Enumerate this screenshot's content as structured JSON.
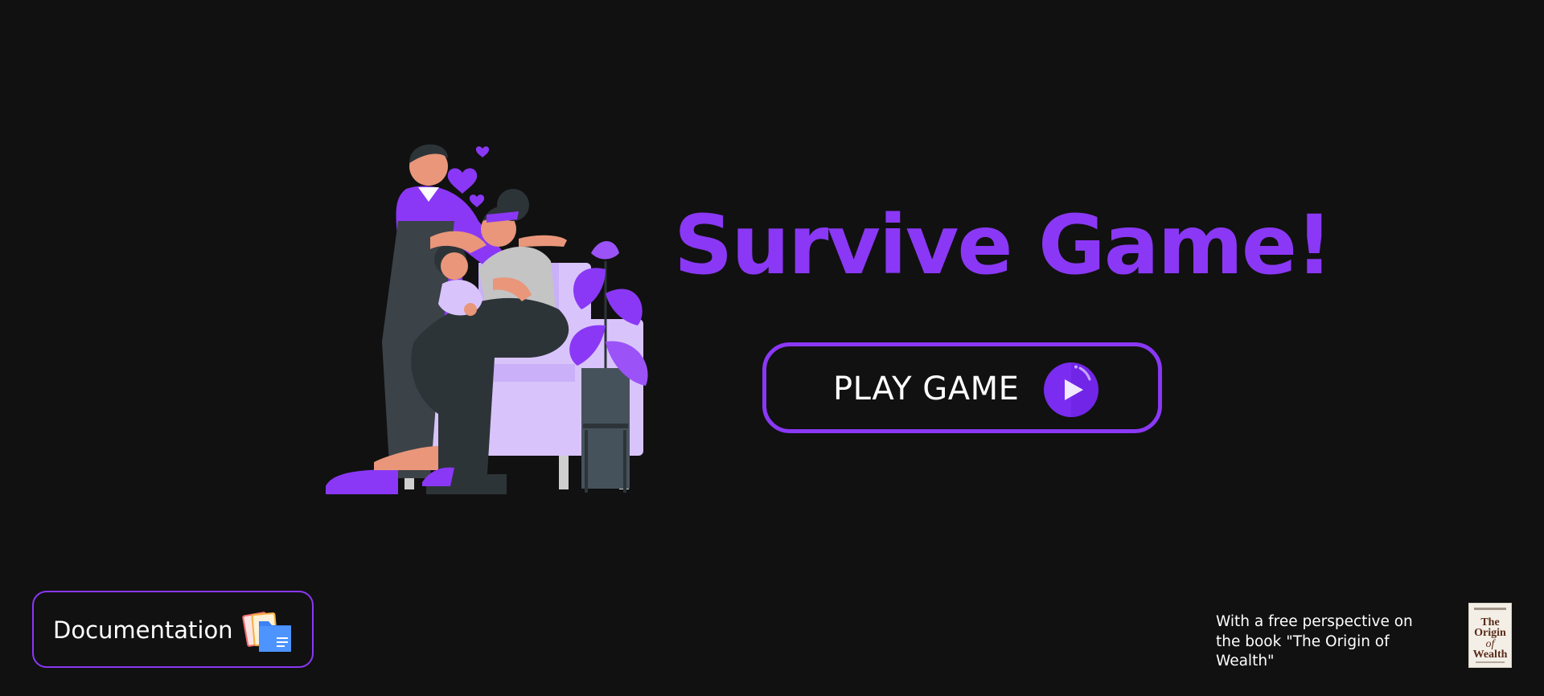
{
  "hero": {
    "title": "Survive Game!",
    "illustration": "family-on-sofa-illustration"
  },
  "play": {
    "label": "PLAY GAME",
    "icon": "play-icon"
  },
  "documentation": {
    "label": "Documentation",
    "icon": "folder-icon"
  },
  "footer": {
    "caption": "With a free perspective on the book \"The Origin of Wealth\"",
    "book_cover": {
      "title_line1": "The",
      "title_line2": "Origin",
      "title_line3": "of",
      "title_line4": "Wealth"
    }
  },
  "colors": {
    "background": "#111111",
    "accent": "#8a38f5",
    "text": "#ffffff"
  }
}
